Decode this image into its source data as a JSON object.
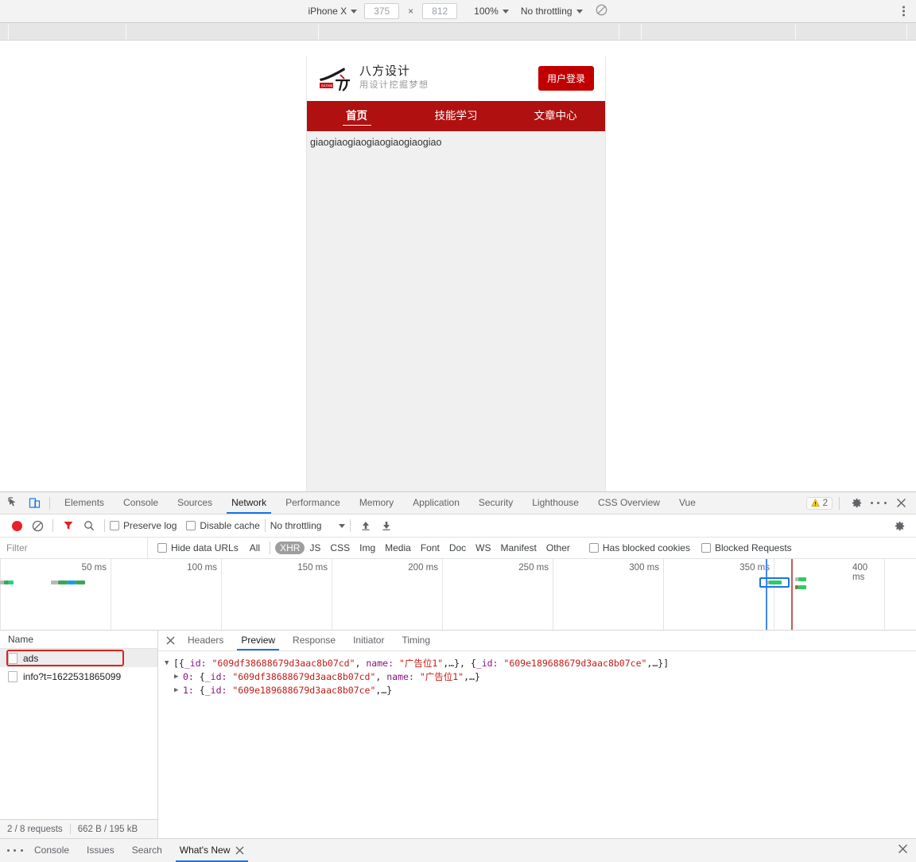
{
  "device_toolbar": {
    "device": "iPhone X",
    "width": "375",
    "height": "812",
    "zoom": "100%",
    "throttling": "No throttling",
    "rotate_icon": "rotate-icon",
    "menu_icon": "more-vertical-icon"
  },
  "page": {
    "brand_title": "八方设计",
    "brand_subtitle": "用设计挖掘梦想",
    "login_label": "用户登录",
    "nav": [
      {
        "label": "首页",
        "active": true
      },
      {
        "label": "技能学习",
        "active": false
      },
      {
        "label": "文章中心",
        "active": false
      }
    ],
    "body_text": "giaogiaogiaogiaogiaogiaogiao",
    "colors": {
      "nav_bg": "#b01010",
      "login_bg": "#c00000"
    }
  },
  "devtools": {
    "tabs": [
      {
        "label": "Elements",
        "active": false
      },
      {
        "label": "Console",
        "active": false
      },
      {
        "label": "Sources",
        "active": false
      },
      {
        "label": "Network",
        "active": true
      },
      {
        "label": "Performance",
        "active": false
      },
      {
        "label": "Memory",
        "active": false
      },
      {
        "label": "Application",
        "active": false
      },
      {
        "label": "Security",
        "active": false
      },
      {
        "label": "Lighthouse",
        "active": false
      },
      {
        "label": "CSS Overview",
        "active": false
      },
      {
        "label": "Vue",
        "active": false
      }
    ],
    "warning_count": "2",
    "icons": {
      "inspect": "inspect-element-icon",
      "device": "toggle-device-toolbar-icon",
      "settings": "gear-icon",
      "more": "more-vertical-icon",
      "close": "close-icon"
    },
    "network_toolbar": {
      "record_label": "record-button",
      "clear_label": "clear-button",
      "filter_icon": "filter-icon",
      "search_icon": "search-icon",
      "preserve_log": "Preserve log",
      "disable_cache": "Disable cache",
      "throttling": "No throttling",
      "import_icon": "upload-har-icon",
      "export_icon": "download-har-icon",
      "settings_icon": "gear-icon"
    },
    "filter_bar": {
      "placeholder": "Filter",
      "value": "",
      "hide_data_urls": "Hide data URLs",
      "types": [
        {
          "label": "All",
          "active": false
        },
        {
          "label": "XHR",
          "active": true
        },
        {
          "label": "JS",
          "active": false
        },
        {
          "label": "CSS",
          "active": false
        },
        {
          "label": "Img",
          "active": false
        },
        {
          "label": "Media",
          "active": false
        },
        {
          "label": "Font",
          "active": false
        },
        {
          "label": "Doc",
          "active": false
        },
        {
          "label": "WS",
          "active": false
        },
        {
          "label": "Manifest",
          "active": false
        },
        {
          "label": "Other",
          "active": false
        }
      ],
      "has_blocked_cookies": "Has blocked cookies",
      "blocked_requests": "Blocked Requests"
    },
    "overview": {
      "ticks": [
        "50 ms",
        "100 ms",
        "150 ms",
        "200 ms",
        "250 ms",
        "300 ms",
        "350 ms",
        "400 ms"
      ],
      "dom_content_loaded_color": "#4287f5",
      "load_color": "#c95a5a"
    },
    "request_list": {
      "column_header": "Name",
      "rows": [
        {
          "name": "ads",
          "selected": true,
          "annotated": true
        },
        {
          "name": "info?t=1622531865099",
          "selected": false,
          "annotated": false
        }
      ],
      "status": {
        "requests": "2 / 8 requests",
        "transferred": "662 B / 195 kB"
      }
    },
    "detail_tabs": [
      {
        "label": "Headers",
        "active": false
      },
      {
        "label": "Preview",
        "active": true
      },
      {
        "label": "Response",
        "active": false
      },
      {
        "label": "Initiator",
        "active": false
      },
      {
        "label": "Timing",
        "active": false
      }
    ],
    "preview": {
      "root": {
        "prefix": "[{",
        "key1": "_id:",
        "val1": "\"609df38688679d3aac8b07cd\"",
        "mid": ", ",
        "key2": "name:",
        "val2": "\"广告位1\"",
        "tail1": ",…}, {",
        "key3": "_id:",
        "val3": "\"609e189688679d3aac8b07ce\"",
        "tail2": ",…}]"
      },
      "item0": {
        "index": "0:",
        "open": "{",
        "key1": "_id:",
        "val1": "\"609df38688679d3aac8b07cd\"",
        "sep": ", ",
        "key2": "name:",
        "val2": "\"广告位1\"",
        "tail": ",…}"
      },
      "item1": {
        "index": "1:",
        "open": "{",
        "key1": "_id:",
        "val1": "\"609e189688679d3aac8b07ce\"",
        "tail": ",…}"
      }
    },
    "drawer": {
      "more_icon": "more-vertical-icon",
      "tabs": [
        {
          "label": "Console",
          "active": false
        },
        {
          "label": "Issues",
          "active": false
        },
        {
          "label": "Search",
          "active": false
        },
        {
          "label": "What's New",
          "active": true
        }
      ],
      "close_icon": "close-icon"
    }
  }
}
